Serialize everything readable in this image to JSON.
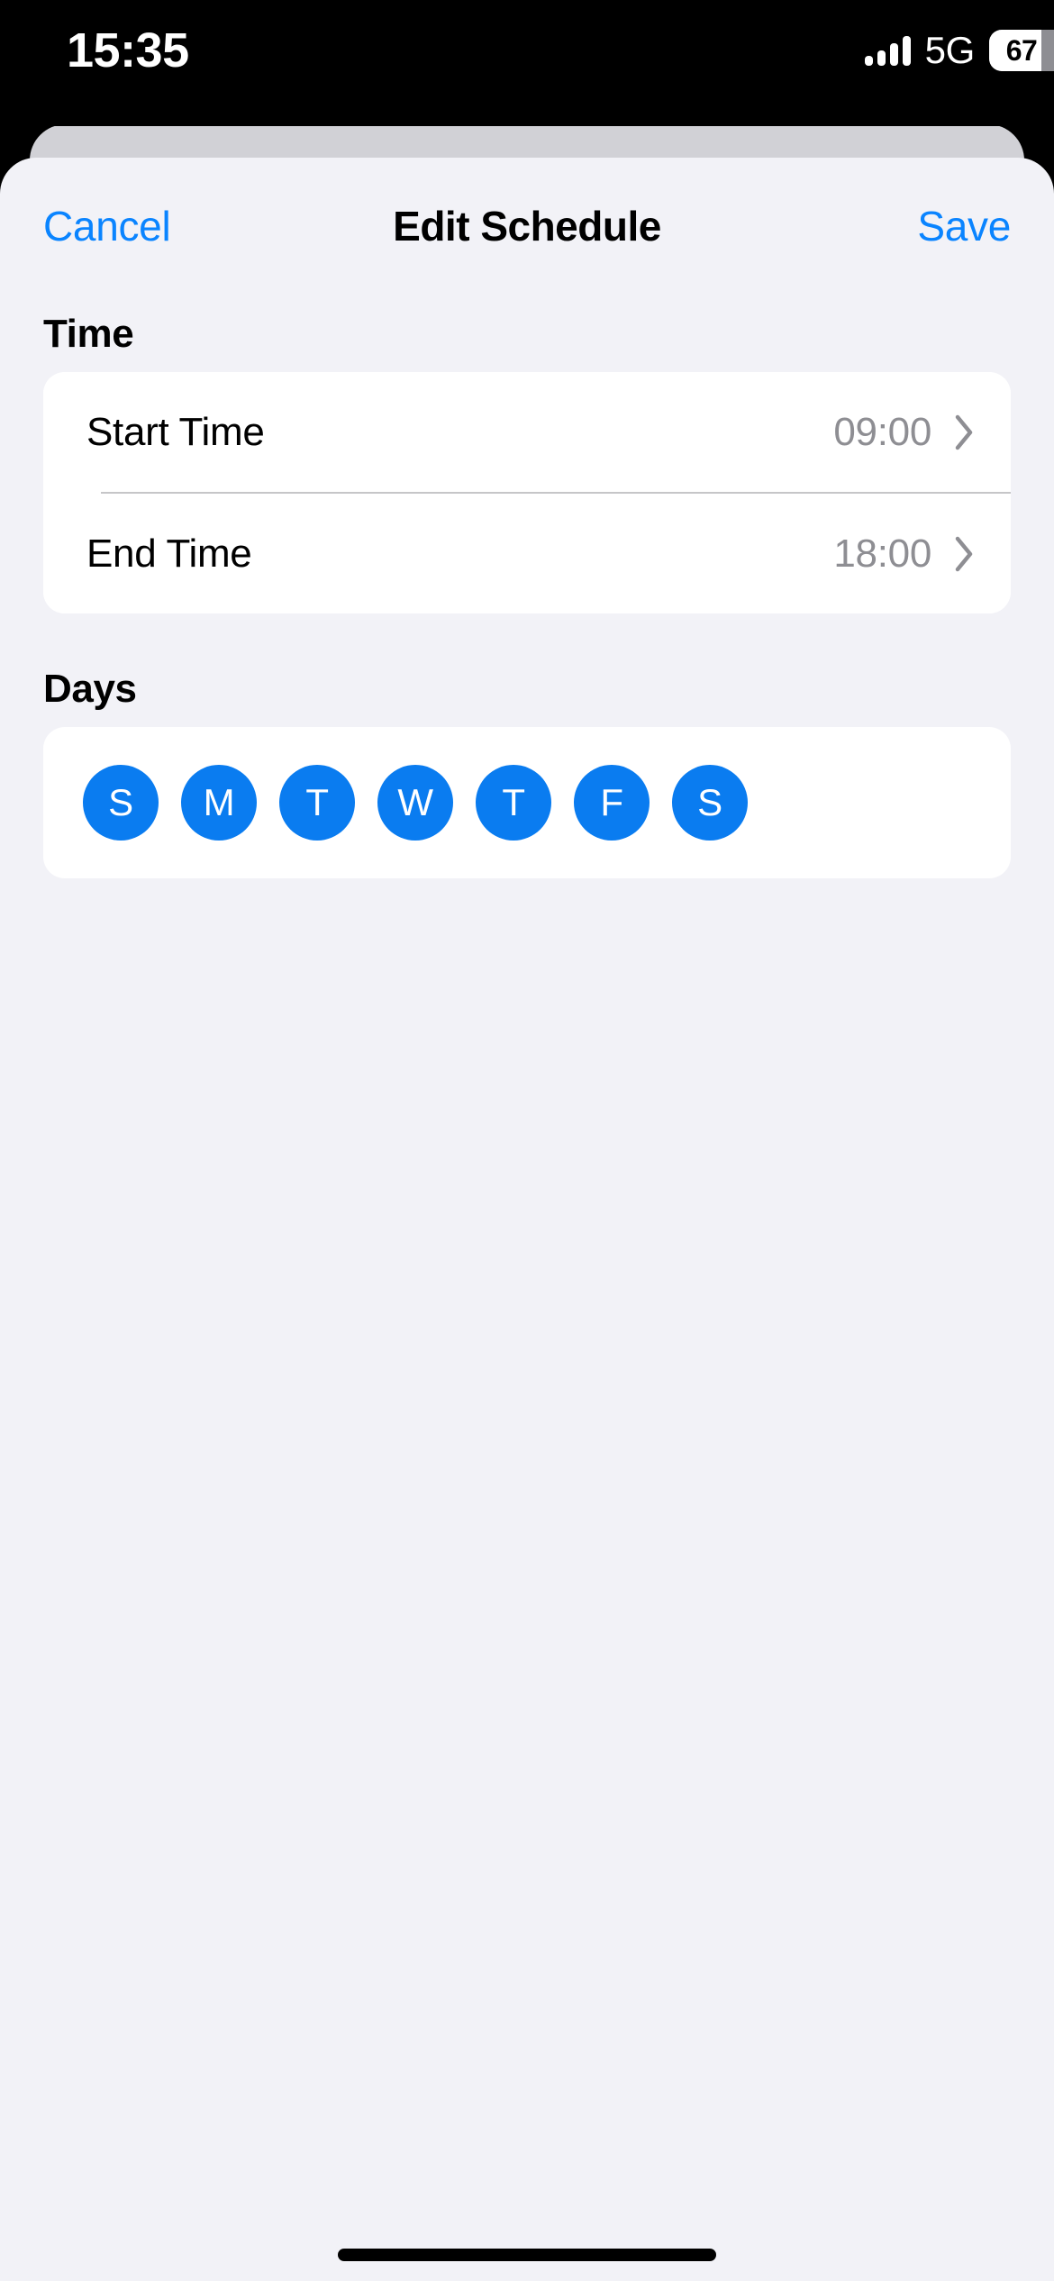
{
  "status_bar": {
    "time": "15:35",
    "network": "5G",
    "battery_level": "67",
    "battery_percent": 67,
    "signal_bars": 4
  },
  "nav": {
    "cancel_label": "Cancel",
    "title": "Edit Schedule",
    "save_label": "Save"
  },
  "sections": {
    "time": {
      "header": "Time",
      "rows": [
        {
          "label": "Start Time",
          "value": "09:00"
        },
        {
          "label": "End Time",
          "value": "18:00"
        }
      ]
    },
    "days": {
      "header": "Days",
      "items": [
        {
          "label": "S",
          "name": "sunday",
          "selected": true
        },
        {
          "label": "M",
          "name": "monday",
          "selected": true
        },
        {
          "label": "T",
          "name": "tuesday",
          "selected": true
        },
        {
          "label": "W",
          "name": "wednesday",
          "selected": true
        },
        {
          "label": "T",
          "name": "thursday",
          "selected": true
        },
        {
          "label": "F",
          "name": "friday",
          "selected": true
        },
        {
          "label": "S",
          "name": "saturday",
          "selected": true
        }
      ]
    }
  },
  "colors": {
    "accent_blue": "#0a84ff",
    "day_selected": "#0a7cf0",
    "sheet_background": "#f2f2f7",
    "card_background": "#ffffff",
    "secondary_text": "#8e8e93",
    "separator": "#c6c6c8"
  }
}
